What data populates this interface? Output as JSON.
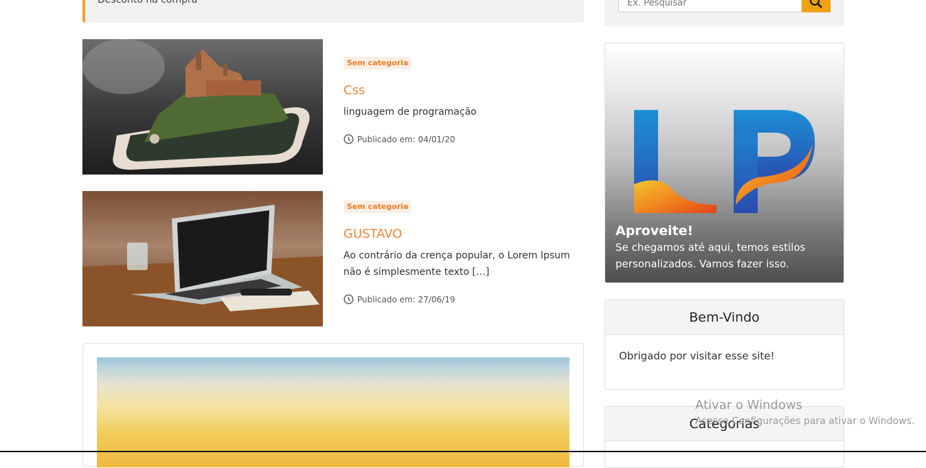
{
  "notice": {
    "text": "Desconto na compra"
  },
  "search": {
    "placeholder": "Ex. Pesquisar",
    "button_icon": "search-icon"
  },
  "posts": [
    {
      "category": "Sem categoria",
      "title": "Css",
      "excerpt": "linguagem de programação",
      "date": "Publicado em: 04/01/20",
      "image": "smartphone with castle"
    },
    {
      "category": "Sem categoria",
      "title": "GUSTAVO",
      "excerpt": "Ao contrário da crença popular, o Lorem Ipsum não é simplesmente texto […]",
      "date": "Publicado em: 27/06/19",
      "image": "laptop on wooden desk"
    }
  ],
  "promo": {
    "logo_text": "LP",
    "title": "Aproveite!",
    "text": "Se chegamos até aqui, temos estilos personalizados. Vamos fazer isso."
  },
  "welcome": {
    "title": "Bem-Vindo",
    "text": "Obrigado por visitar esse site!"
  },
  "categories": {
    "title": "Categorias"
  },
  "watermark": {
    "line1": "Ativar o Windows",
    "line2": "Acesse Configurações para ativar o Windows."
  },
  "colors": {
    "accent": "#f0883a",
    "search_button": "#f0a110",
    "badge_bg": "#fbeee4"
  }
}
